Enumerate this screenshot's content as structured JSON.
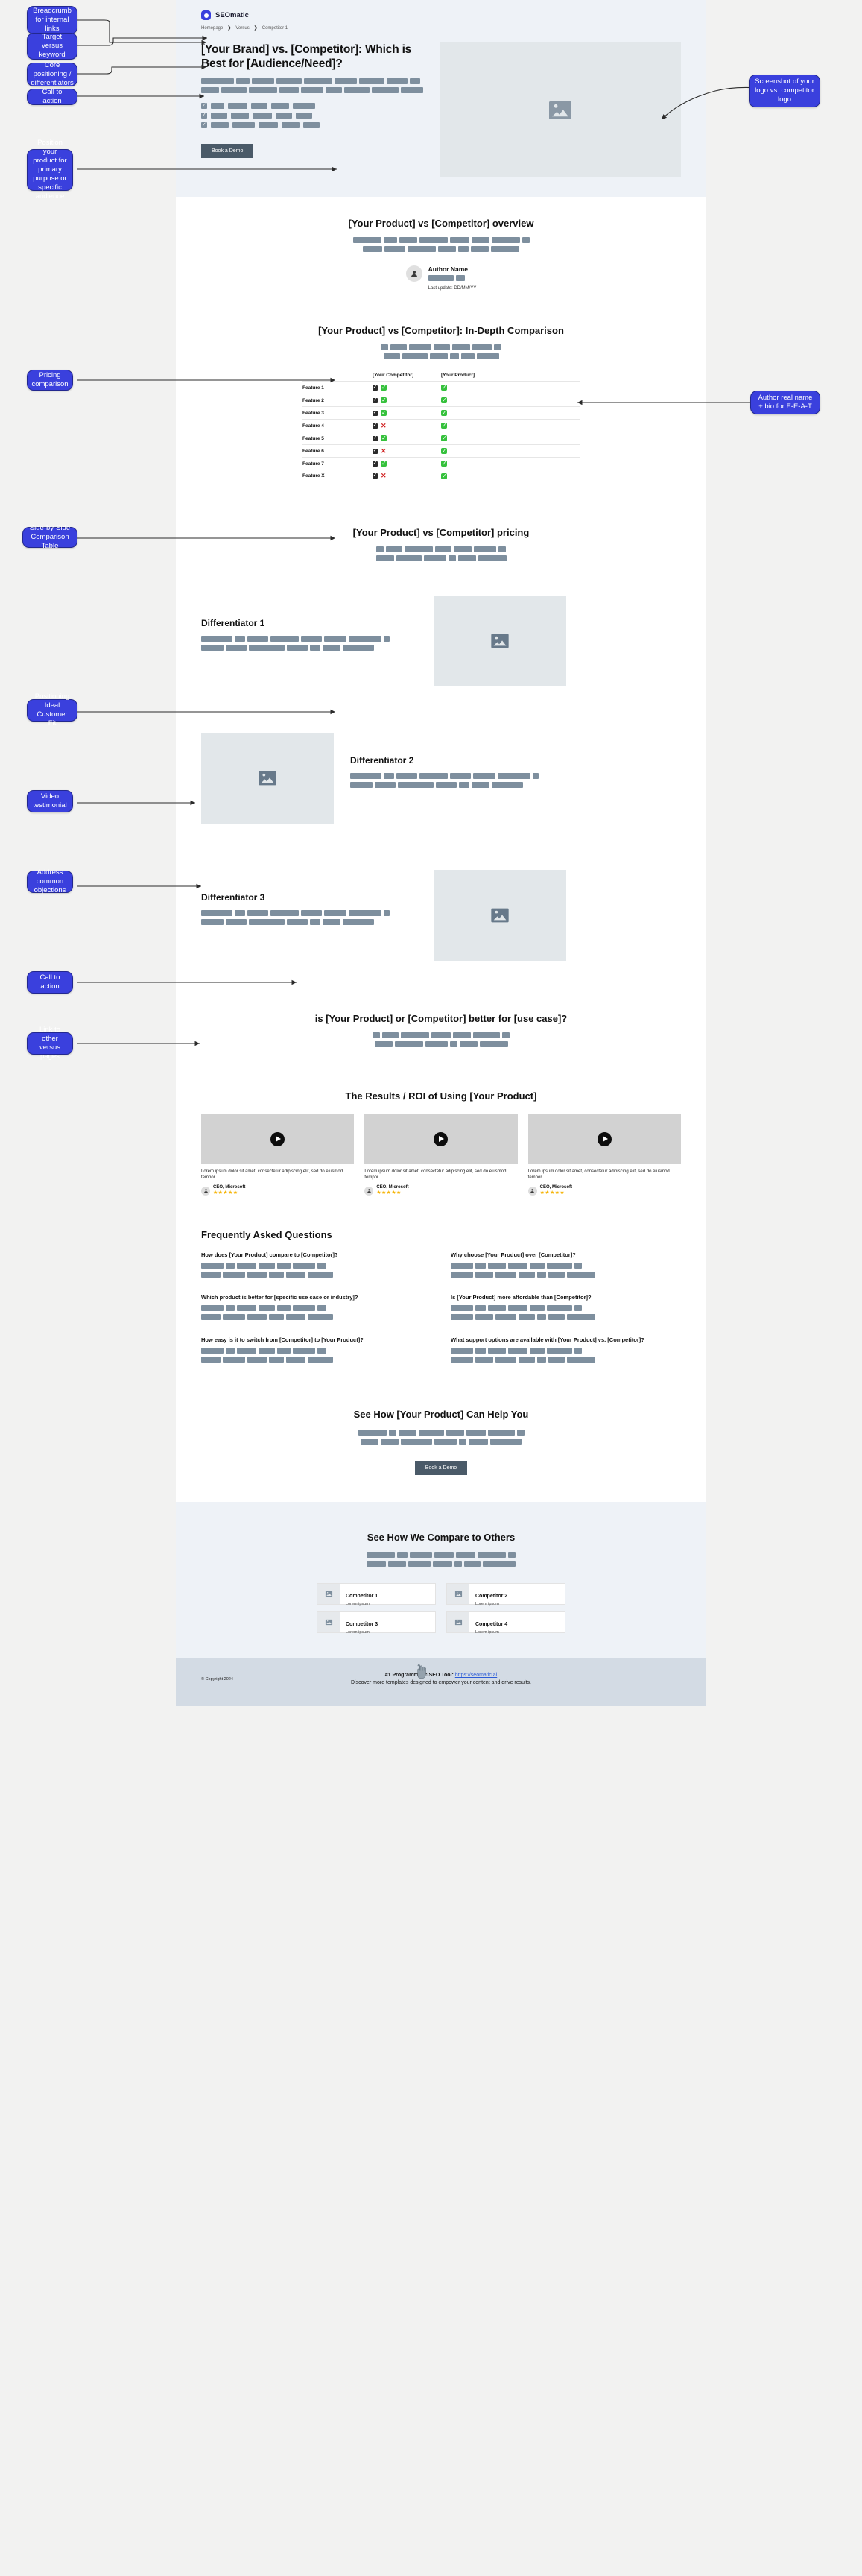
{
  "brand": {
    "name": "SEOmatic",
    "logo_icon": "seomatic-logo-icon"
  },
  "breadcrumbs": [
    {
      "label": "Homepage"
    },
    {
      "label": "Versus"
    },
    {
      "label": "Competitor 1"
    }
  ],
  "breadcrumb_separator": "❯",
  "hero": {
    "heading": "[Your Brand] vs. [Competitor]: Which is Best for [Audience/Need]?",
    "cta_label": "Book a Demo",
    "image_icon": "image-placeholder-icon"
  },
  "overview": {
    "heading": "[Your Product] vs [Competitor] overview",
    "author_name": "Author Name",
    "author_meta": "Last update: DD/MM/YY",
    "avatar_icon": "user-avatar-icon"
  },
  "comparison": {
    "heading": "[Your Product] vs [Competitor]: In-Depth Comparison",
    "columns": [
      "",
      "[Your Competitor]",
      "[Your Product]"
    ],
    "rows": [
      {
        "feature": "Feature 1",
        "competitor": "yes",
        "product": "yes"
      },
      {
        "feature": "Feature 2",
        "competitor": "yes",
        "product": "yes"
      },
      {
        "feature": "Feature 3",
        "competitor": "yes",
        "product": "yes"
      },
      {
        "feature": "Feature 4",
        "competitor": "no",
        "product": "yes"
      },
      {
        "feature": "Feature 5",
        "competitor": "yes",
        "product": "yes"
      },
      {
        "feature": "Feature 6",
        "competitor": "no",
        "product": "yes"
      },
      {
        "feature": "Feature 7",
        "competitor": "yes",
        "product": "yes"
      },
      {
        "feature": "Feature X",
        "competitor": "no",
        "product": "yes"
      }
    ]
  },
  "pricing": {
    "heading": "[Your Product] vs [Competitor] pricing"
  },
  "differentiators": [
    {
      "heading": "Differentiator 1",
      "image_icon": "image-placeholder-icon",
      "image_side": "right"
    },
    {
      "heading": "Differentiator 2",
      "image_icon": "image-placeholder-icon",
      "image_side": "left"
    },
    {
      "heading": "Differentiator 3",
      "image_icon": "image-placeholder-icon",
      "image_side": "right"
    }
  ],
  "use_case": {
    "heading": "is [Your Product] or [Competitor] better for [use case]?"
  },
  "results": {
    "heading": "The Results / ROI of Using [Your Product]",
    "testimonials": [
      {
        "quote": "Lorem ipsum dolor sit amet, consectetur adipiscing elit, sed do eiusmod tempor",
        "role": "CEO, Microsoft",
        "stars": "★★★★★",
        "play_icon": "play-icon",
        "avatar_icon": "user-avatar-icon"
      },
      {
        "quote": "Lorem ipsum dolor sit amet, consectetur adipiscing elit, sed do eiusmod tempor",
        "role": "CEO, Microsoft",
        "stars": "★★★★★",
        "play_icon": "play-icon",
        "avatar_icon": "user-avatar-icon"
      },
      {
        "quote": "Lorem ipsum dolor sit amet, consectetur adipiscing elit, sed do eiusmod tempor",
        "role": "CEO, Microsoft",
        "stars": "★★★★★",
        "play_icon": "play-icon",
        "avatar_icon": "user-avatar-icon"
      }
    ]
  },
  "faq": {
    "heading": "Frequently Asked Questions",
    "items": [
      {
        "question": "How does [Your Product] compare to [Competitor]?"
      },
      {
        "question": "Why choose [Your Product] over [Competitor]?"
      },
      {
        "question": "Which product is better for [specific use case or industry]?"
      },
      {
        "question": "Is [Your Product] more affordable than [Competitor]?"
      },
      {
        "question": "How easy is it to switch from [Competitor] to [Your Product]?"
      },
      {
        "question": "What support options are available with [Your Product] vs. [Competitor]?"
      }
    ]
  },
  "cta": {
    "heading": "See How [Your Product] Can Help You",
    "button_label": "Book a Demo"
  },
  "compare_others": {
    "heading": "See How We Compare to Others",
    "cards": [
      {
        "name": "Competitor 1",
        "desc": "Lorem ipsum",
        "icon": "image-placeholder-icon"
      },
      {
        "name": "Competitor 2",
        "desc": "Lorem ipsum",
        "icon": "image-placeholder-icon"
      },
      {
        "name": "Competitor 3",
        "desc": "Lorem ipsum",
        "icon": "image-placeholder-icon"
      },
      {
        "name": "Competitor 4",
        "desc": "Lorem ipsum",
        "icon": "image-placeholder-icon"
      }
    ],
    "cursor_icon": "hand-cursor-icon"
  },
  "footer": {
    "copyright": "© Copyright 2024",
    "tagline_strong": "#1 Programmatic SEO Tool:",
    "tagline_link": "https://seomatic.ai",
    "tagline_rest": "Discover more templates designed to empower your content and drive results."
  },
  "annotations": {
    "accent_color": "#3a40dd",
    "left": [
      {
        "label": "Breadcrumb for internal links"
      },
      {
        "label": "Target versus keyword"
      },
      {
        "label": "Core positioning / differentiators"
      },
      {
        "label": "Call to action"
      },
      {
        "label": "Position your product for primary purpose or specific audience"
      },
      {
        "label": "Side-by-Side Comparison Table"
      },
      {
        "label": "Pricing comparison"
      },
      {
        "label": "Positioning Ideal Customer Fit"
      },
      {
        "label": "Video testimonial"
      },
      {
        "label": "Address common objections"
      },
      {
        "label": "Call to action"
      },
      {
        "label": "Link to other versus pages"
      }
    ],
    "right": [
      {
        "label": "Screenshot of your logo vs. competitor logo"
      },
      {
        "label": "Author real name + bio for E-E-A-T"
      }
    ]
  }
}
